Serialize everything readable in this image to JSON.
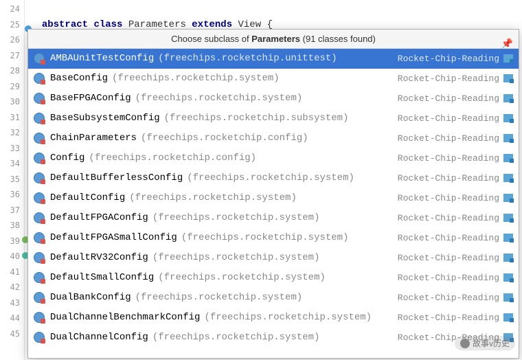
{
  "gutter": [
    "24",
    "25",
    "26",
    "27",
    "28",
    "29",
    "30",
    "31",
    "32",
    "33",
    "34",
    "35",
    "36",
    "37",
    "38",
    "39",
    "40",
    "41",
    "42",
    "43",
    "44",
    "45"
  ],
  "code_line": {
    "kw1": "abstract",
    "kw2": "class",
    "name": "Parameters",
    "kw3": "extends",
    "sup": "View",
    "brace": "{"
  },
  "popup": {
    "prefix": "Choose subclass of ",
    "subject": "Parameters",
    "suffix": " (",
    "count": "91 classes found",
    "tail": ")"
  },
  "rows": [
    {
      "cls": "AMBAUnitTestConfig",
      "pkg": "(freechips.rocketchip.unittest)",
      "mod": "Rocket-Chip-Reading",
      "sel": true
    },
    {
      "cls": "BaseConfig",
      "pkg": "(freechips.rocketchip.system)",
      "mod": "Rocket-Chip-Reading"
    },
    {
      "cls": "BaseFPGAConfig",
      "pkg": "(freechips.rocketchip.system)",
      "mod": "Rocket-Chip-Reading"
    },
    {
      "cls": "BaseSubsystemConfig",
      "pkg": "(freechips.rocketchip.subsystem)",
      "mod": "Rocket-Chip-Reading"
    },
    {
      "cls": "ChainParameters",
      "pkg": "(freechips.rocketchip.config)",
      "mod": "Rocket-Chip-Reading"
    },
    {
      "cls": "Config",
      "pkg": "(freechips.rocketchip.config)",
      "mod": "Rocket-Chip-Reading"
    },
    {
      "cls": "DefaultBufferlessConfig",
      "pkg": "(freechips.rocketchip.system)",
      "mod": "Rocket-Chip-Reading"
    },
    {
      "cls": "DefaultConfig",
      "pkg": "(freechips.rocketchip.system)",
      "mod": "Rocket-Chip-Reading"
    },
    {
      "cls": "DefaultFPGAConfig",
      "pkg": "(freechips.rocketchip.system)",
      "mod": "Rocket-Chip-Reading"
    },
    {
      "cls": "DefaultFPGASmallConfig",
      "pkg": "(freechips.rocketchip.system)",
      "mod": "Rocket-Chip-Reading"
    },
    {
      "cls": "DefaultRV32Config",
      "pkg": "(freechips.rocketchip.system)",
      "mod": "Rocket-Chip-Reading"
    },
    {
      "cls": "DefaultSmallConfig",
      "pkg": "(freechips.rocketchip.system)",
      "mod": "Rocket-Chip-Reading"
    },
    {
      "cls": "DualBankConfig",
      "pkg": "(freechips.rocketchip.system)",
      "mod": "Rocket-Chip-Reading"
    },
    {
      "cls": "DualChannelBenchmarkConfig",
      "pkg": "(freechips.rocketchip.system)",
      "mod": "Rocket-Chip-Reading"
    },
    {
      "cls": "DualChannelConfig",
      "pkg": "(freechips.rocketchip.system)",
      "mod": "Rocket-Chip-Reading"
    }
  ],
  "watermark": "故事v历史"
}
